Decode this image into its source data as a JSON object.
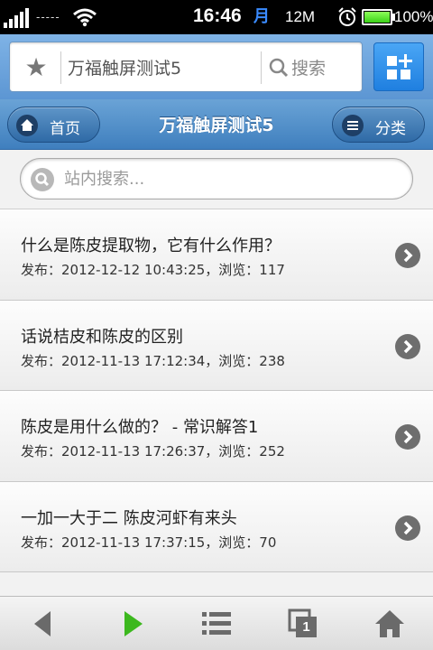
{
  "statusbar": {
    "carrier": "-----",
    "time": "16:46",
    "calendar_glyph": "月",
    "memory": "12M",
    "battery_level": 1.0,
    "battery_pct": "100%",
    "icons": [
      "signal-icon",
      "wifi-icon",
      "calendar-icon",
      "alarm-icon",
      "battery-icon"
    ]
  },
  "urlbar": {
    "title": "万福触屏测试5",
    "search_label": "搜索",
    "icons": [
      "star-icon",
      "search-icon",
      "grid-menu-icon"
    ]
  },
  "header": {
    "home_label": "首页",
    "title": "万福触屏测试5",
    "category_label": "分类",
    "icons": [
      "home-icon",
      "list-icon"
    ]
  },
  "site_search": {
    "placeholder": "站内搜索..."
  },
  "articles": [
    {
      "title": "什么是陈皮提取物，它有什么作用？",
      "meta": "发布：2012-12-12 10:43:25，浏览：117"
    },
    {
      "title": "话说桔皮和陈皮的区别",
      "meta": "发布：2012-11-13 17:12:34，浏览：238"
    },
    {
      "title": "陈皮是用什么做的？ - 常识解答1",
      "meta": "发布：2012-11-13 17:26:37，浏览：252"
    },
    {
      "title": "一加一大于二 陈皮河虾有来头",
      "meta": "发布：2012-11-13 17:37:15，浏览：70"
    }
  ],
  "toolbar": {
    "icons": [
      "back-icon",
      "forward-icon",
      "menu-icon",
      "windows-icon",
      "home-icon"
    ],
    "windows_count": "1"
  },
  "colors": {
    "accent_blue": "#3f7fbe",
    "forward_green": "#3cb81e",
    "toolbar_icon_gray": "#6a6a6a"
  }
}
